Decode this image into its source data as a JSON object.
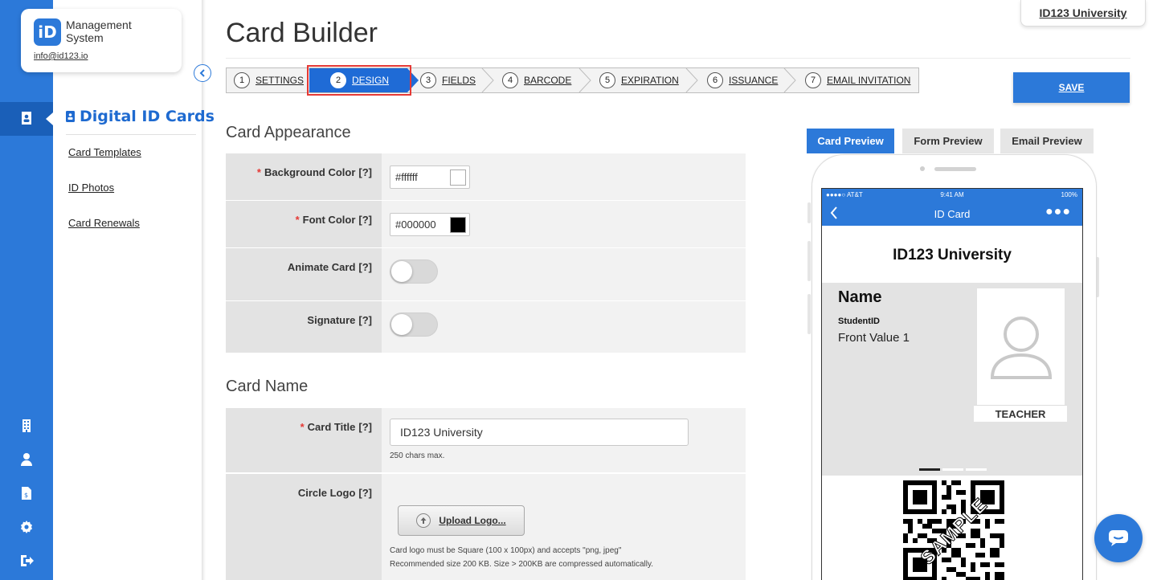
{
  "brand": {
    "logo_text": "iD",
    "name_line1": "Management",
    "name_line2": "System",
    "email": "info@id123.io"
  },
  "org_tab": "ID123 University",
  "sidebar": {
    "title": "Digital ID Cards",
    "links": [
      "Card Templates",
      "ID Photos",
      "Card Renewals"
    ]
  },
  "rail_icons": [
    "id-card-icon",
    "building-icon",
    "user-icon",
    "invoice-icon",
    "gear-icon",
    "logout-icon"
  ],
  "page_title": "Card Builder",
  "steps": [
    {
      "num": "1",
      "label": "SETTINGS"
    },
    {
      "num": "2",
      "label": "DESIGN"
    },
    {
      "num": "3",
      "label": "FIELDS"
    },
    {
      "num": "4",
      "label": "BARCODE"
    },
    {
      "num": "5",
      "label": "EXPIRATION"
    },
    {
      "num": "6",
      "label": "ISSUANCE"
    },
    {
      "num": "7",
      "label": "EMAIL INVITATION"
    }
  ],
  "active_step": "DESIGN",
  "save_label": "SAVE",
  "appearance": {
    "title": "Card Appearance",
    "bg_color_label": "Background Color",
    "bg_color_value": "#ffffff",
    "font_color_label": "Font Color",
    "font_color_value": "#000000",
    "animate_label": "Animate Card",
    "animate_on": false,
    "signature_label": "Signature",
    "signature_on": false,
    "help": "[?]",
    "req": "*"
  },
  "card_name": {
    "title": "Card Name",
    "card_title_label": "Card Title",
    "card_title_value": "ID123 University",
    "card_title_hint": "250 chars max.",
    "logo_label": "Circle Logo",
    "upload_label": "Upload Logo...",
    "logo_hint1": "Card logo must be Square (100 x 100px) and accepts \"png, jpeg\"",
    "logo_hint2": "Recommended size 200 KB. Size > 200KB are compressed automatically."
  },
  "preview_tabs": [
    "Card Preview",
    "Form Preview",
    "Email Preview"
  ],
  "active_preview": "Card Preview",
  "phone": {
    "carrier": "●●●●○ AT&T",
    "time": "9:41 AM",
    "battery": "100%",
    "nav_title": "ID Card",
    "card_univ": "ID123 University",
    "name": "Name",
    "field_label": "StudentID",
    "field_value": "Front Value 1",
    "role": "TEACHER",
    "watermark": "SAMPLE"
  },
  "colors": {
    "primary": "#2c79d9",
    "active_step": "#1f6bd6",
    "highlight": "#e53935"
  }
}
